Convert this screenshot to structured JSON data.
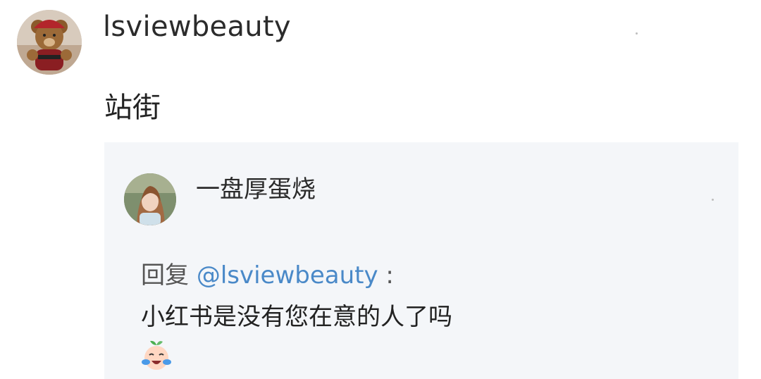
{
  "comment": {
    "username": "lsviewbeauty",
    "text": "站街",
    "avatar_icon": "teddy-bear-avatar-icon"
  },
  "quoted_reply": {
    "username": "一盘厚蛋烧",
    "avatar_icon": "user-photo-avatar-icon",
    "reply_prefix": "回复",
    "mention": "@lsviewbeauty",
    "colon": ":",
    "body": "小红书是没有您在意的人了吗",
    "emoji_icon": "crying-sprout-emoji-icon"
  },
  "colors": {
    "quote_background": "#f4f6f9",
    "mention": "#4a89c8",
    "text": "#222222"
  }
}
